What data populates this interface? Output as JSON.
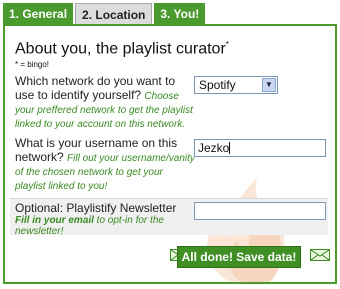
{
  "tabs": [
    {
      "label": "1. General"
    },
    {
      "label": "2. Location"
    },
    {
      "label": "3. You!"
    }
  ],
  "header": {
    "title": "About you, the playlist curator",
    "title_mark": "*",
    "note": "* = bingo!"
  },
  "network": {
    "question": "Which network do you want to use to identify yourself?",
    "hint": "Choose your preffered network to get the playlist linked to your account on this network.",
    "selected": "Spotify"
  },
  "username": {
    "question": "What is your username on this network?",
    "hint": "Fill out your username/vanity of the chosen network to get your playlist linked to you!",
    "value": "Jezko"
  },
  "newsletter": {
    "title": "Optional: Playlistify Newsletter",
    "hint_bold": "Fill in your email",
    "hint_rest": " to opt-in for the newsletter!",
    "value": ""
  },
  "actions": {
    "save_label": "All done! Save data!"
  },
  "colors": {
    "accent_green": "#4a9a2e",
    "hint_green": "#3a8a22"
  }
}
